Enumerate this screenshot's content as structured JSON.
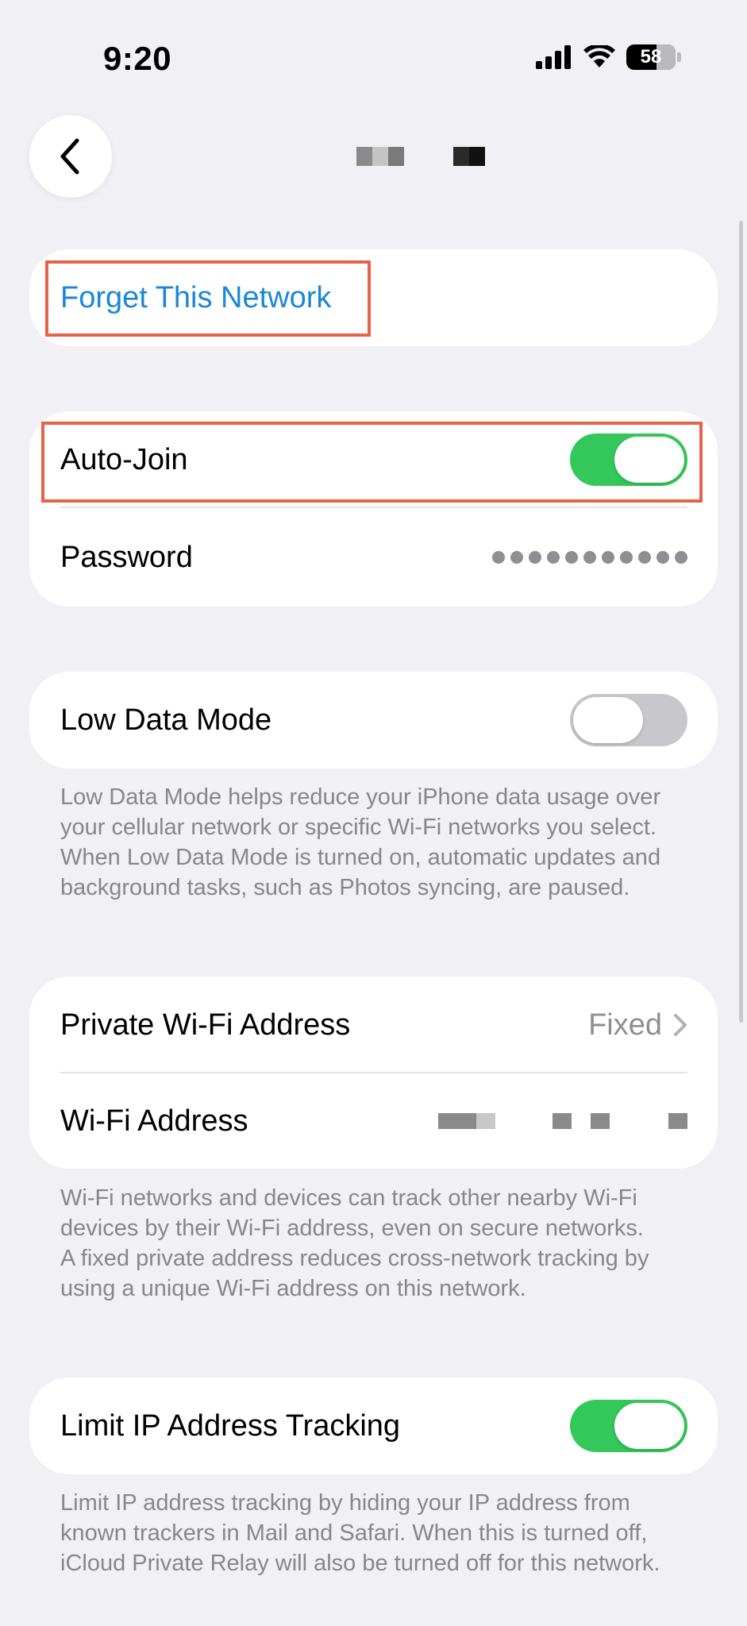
{
  "status_bar": {
    "time": "9:20",
    "battery_level": "58"
  },
  "nav": {
    "back_icon": "chevron-left-icon"
  },
  "forget_network": {
    "label": "Forget This Network"
  },
  "auto_join": {
    "label": "Auto-Join",
    "enabled": true
  },
  "password": {
    "label": "Password",
    "masked_dot_count": 11
  },
  "low_data_mode": {
    "label": "Low Data Mode",
    "enabled": false,
    "footnote": "Low Data Mode helps reduce your iPhone data usage over your cellular network or specific Wi-Fi networks you select. When Low Data Mode is turned on, automatic updates and background tasks, such as Photos syncing, are paused."
  },
  "private_address": {
    "label": "Private Wi-Fi Address",
    "value": "Fixed",
    "chevron_icon": "chevron-right-icon"
  },
  "wifi_address": {
    "label": "Wi-Fi Address",
    "footnote_1": "Wi-Fi networks and devices can track other nearby Wi-Fi devices by their Wi-Fi address, even on secure networks.",
    "footnote_2": "A fixed private address reduces cross-network tracking by using a unique Wi-Fi address on this network."
  },
  "limit_ip": {
    "label": "Limit IP Address Tracking",
    "enabled": true,
    "footnote": "Limit IP address tracking by hiding your IP address from known trackers in Mail and Safari. When this is turned off, iCloud Private Relay will also be turned off for this network."
  },
  "colors": {
    "background": "#f0f0f5",
    "toggle_on": "#34c759",
    "toggle_off": "#c7c7cc",
    "link_blue": "#1a87d8",
    "highlight": "#e8624a",
    "footnote_gray": "#86868b"
  }
}
